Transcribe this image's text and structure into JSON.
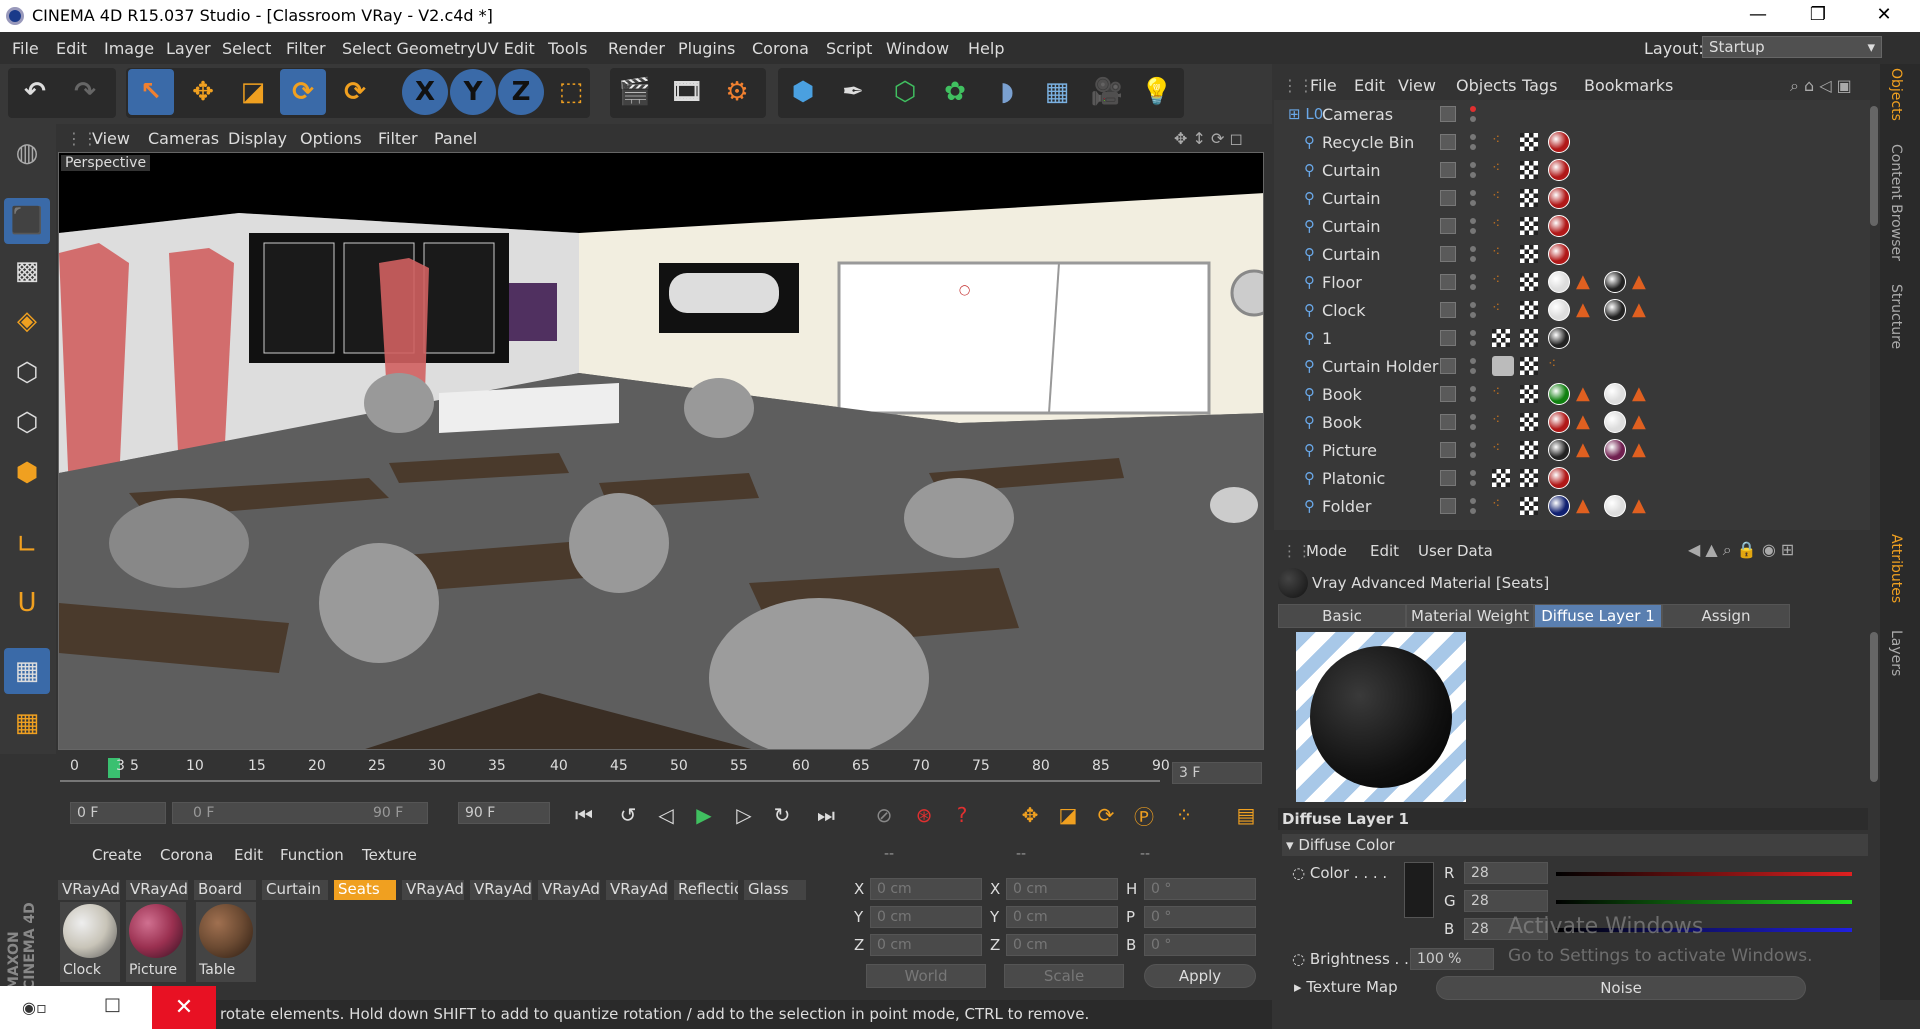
{
  "window": {
    "title": "CINEMA 4D R15.037 Studio - [Classroom VRay - V2.c4d *]",
    "minimize": "—",
    "maximize": "❐",
    "close": "✕"
  },
  "menubar": {
    "items": [
      "File",
      "Edit",
      "Image",
      "Layer",
      "Select",
      "Filter",
      "Select Geometry",
      "UV Edit",
      "Tools",
      "Render",
      "Plugins",
      "Corona",
      "Script",
      "Window",
      "Help"
    ],
    "layout_label": "Layout:",
    "layout_value": "Startup"
  },
  "toolbar": {
    "icons": [
      "undo-icon",
      "redo-icon",
      "live-selection-icon",
      "move-icon",
      "scale-icon",
      "rotate-icon",
      "rotate-alt-icon",
      "x-axis-icon",
      "y-axis-icon",
      "z-axis-icon",
      "coordinate-system-icon",
      "render-view-icon",
      "render-picture-viewer-icon",
      "render-settings-icon",
      "cube-icon",
      "spline-pen-icon",
      "subdivision-icon",
      "array-icon",
      "deformer-icon",
      "floor-icon",
      "camera-icon",
      "light-icon"
    ]
  },
  "viewport": {
    "menu": [
      "View",
      "Cameras",
      "Display",
      "Options",
      "Filter",
      "Panel"
    ],
    "label": "Perspective"
  },
  "timeline": {
    "ticks": [
      "0",
      "5",
      "10",
      "15",
      "20",
      "25",
      "30",
      "35",
      "40",
      "45",
      "50",
      "55",
      "60",
      "65",
      "70",
      "75",
      "80",
      "85",
      "90"
    ],
    "current_marker": "3",
    "frame_display": "3 F"
  },
  "playback": {
    "start": "0 F",
    "range_start": "0 F",
    "range_end": "90 F",
    "end": "90 F"
  },
  "material_manager": {
    "menu": [
      "Create",
      "Corona",
      "Edit",
      "Function",
      "Texture"
    ],
    "tabs": [
      "VRayAdv",
      "VRayAdv",
      "Board",
      "Curtain",
      "Seats",
      "VRayAdv",
      "VRayAdv",
      "VRayAdv",
      "VRayAdv",
      "Reflectic",
      "Glass"
    ],
    "active_tab": "Seats",
    "materials": [
      {
        "name": "Clock",
        "color": "#c8c4b8"
      },
      {
        "name": "Picture",
        "color": "#9a3050"
      },
      {
        "name": "Table",
        "color": "#6b4a32"
      }
    ]
  },
  "coords": {
    "headers": [
      "--",
      "--",
      "--"
    ],
    "rows": [
      {
        "a": "X",
        "av": "0 cm",
        "b": "X",
        "bv": "0 cm",
        "c": "H",
        "cv": "0 °"
      },
      {
        "a": "Y",
        "av": "0 cm",
        "b": "Y",
        "bv": "0 cm",
        "c": "P",
        "cv": "0 °"
      },
      {
        "a": "Z",
        "av": "0 cm",
        "b": "Z",
        "bv": "0 cm",
        "c": "B",
        "cv": "0 °"
      }
    ],
    "world": "World",
    "scale": "Scale",
    "apply": "Apply"
  },
  "object_manager": {
    "menu": [
      "File",
      "Edit",
      "View",
      "Objects",
      "Tags",
      "Bookmarks"
    ],
    "objects": [
      "Cameras",
      "Recycle Bin",
      "Curtain",
      "Curtain",
      "Curtain",
      "Curtain",
      "Floor",
      "Clock",
      "1",
      "Curtain Holder",
      "Book",
      "Book",
      "Picture",
      "Platonic",
      "Folder"
    ]
  },
  "attributes": {
    "menu": [
      "Mode",
      "Edit",
      "User Data"
    ],
    "material_title": "Vray Advanced Material [Seats]",
    "tabs": [
      "Basic",
      "Material Weight",
      "Diffuse Layer 1",
      "Assign"
    ],
    "active_tab": "Diffuse Layer 1",
    "section": "Diffuse Layer 1",
    "subsection": "Diffuse Color",
    "color_label": "Color . . . .",
    "r_label": "R",
    "r": "28",
    "g_label": "G",
    "g": "28",
    "b_label": "B",
    "b": "28",
    "brightness_label": "Brightness . .",
    "brightness": "100 %",
    "texture_label": "Texture Map",
    "texture_value": "Noise",
    "watermark1": "Activate Windows",
    "watermark2": "Go to Settings to activate Windows."
  },
  "right_tabs": [
    "Objects",
    "Content Browser",
    "Structure",
    "Attributes",
    "Layers"
  ],
  "status": {
    "text": "rotate elements. Hold down SHIFT to add to quantize rotation / add to the selection in point mode, CTRL to remove."
  },
  "brand": {
    "maxon": "MAXON",
    "c4d": "CINEMA 4D"
  },
  "colors": {
    "accent": "#f0a020",
    "active_tab": "#5a7fb0",
    "highlight": "#3a78c8"
  }
}
